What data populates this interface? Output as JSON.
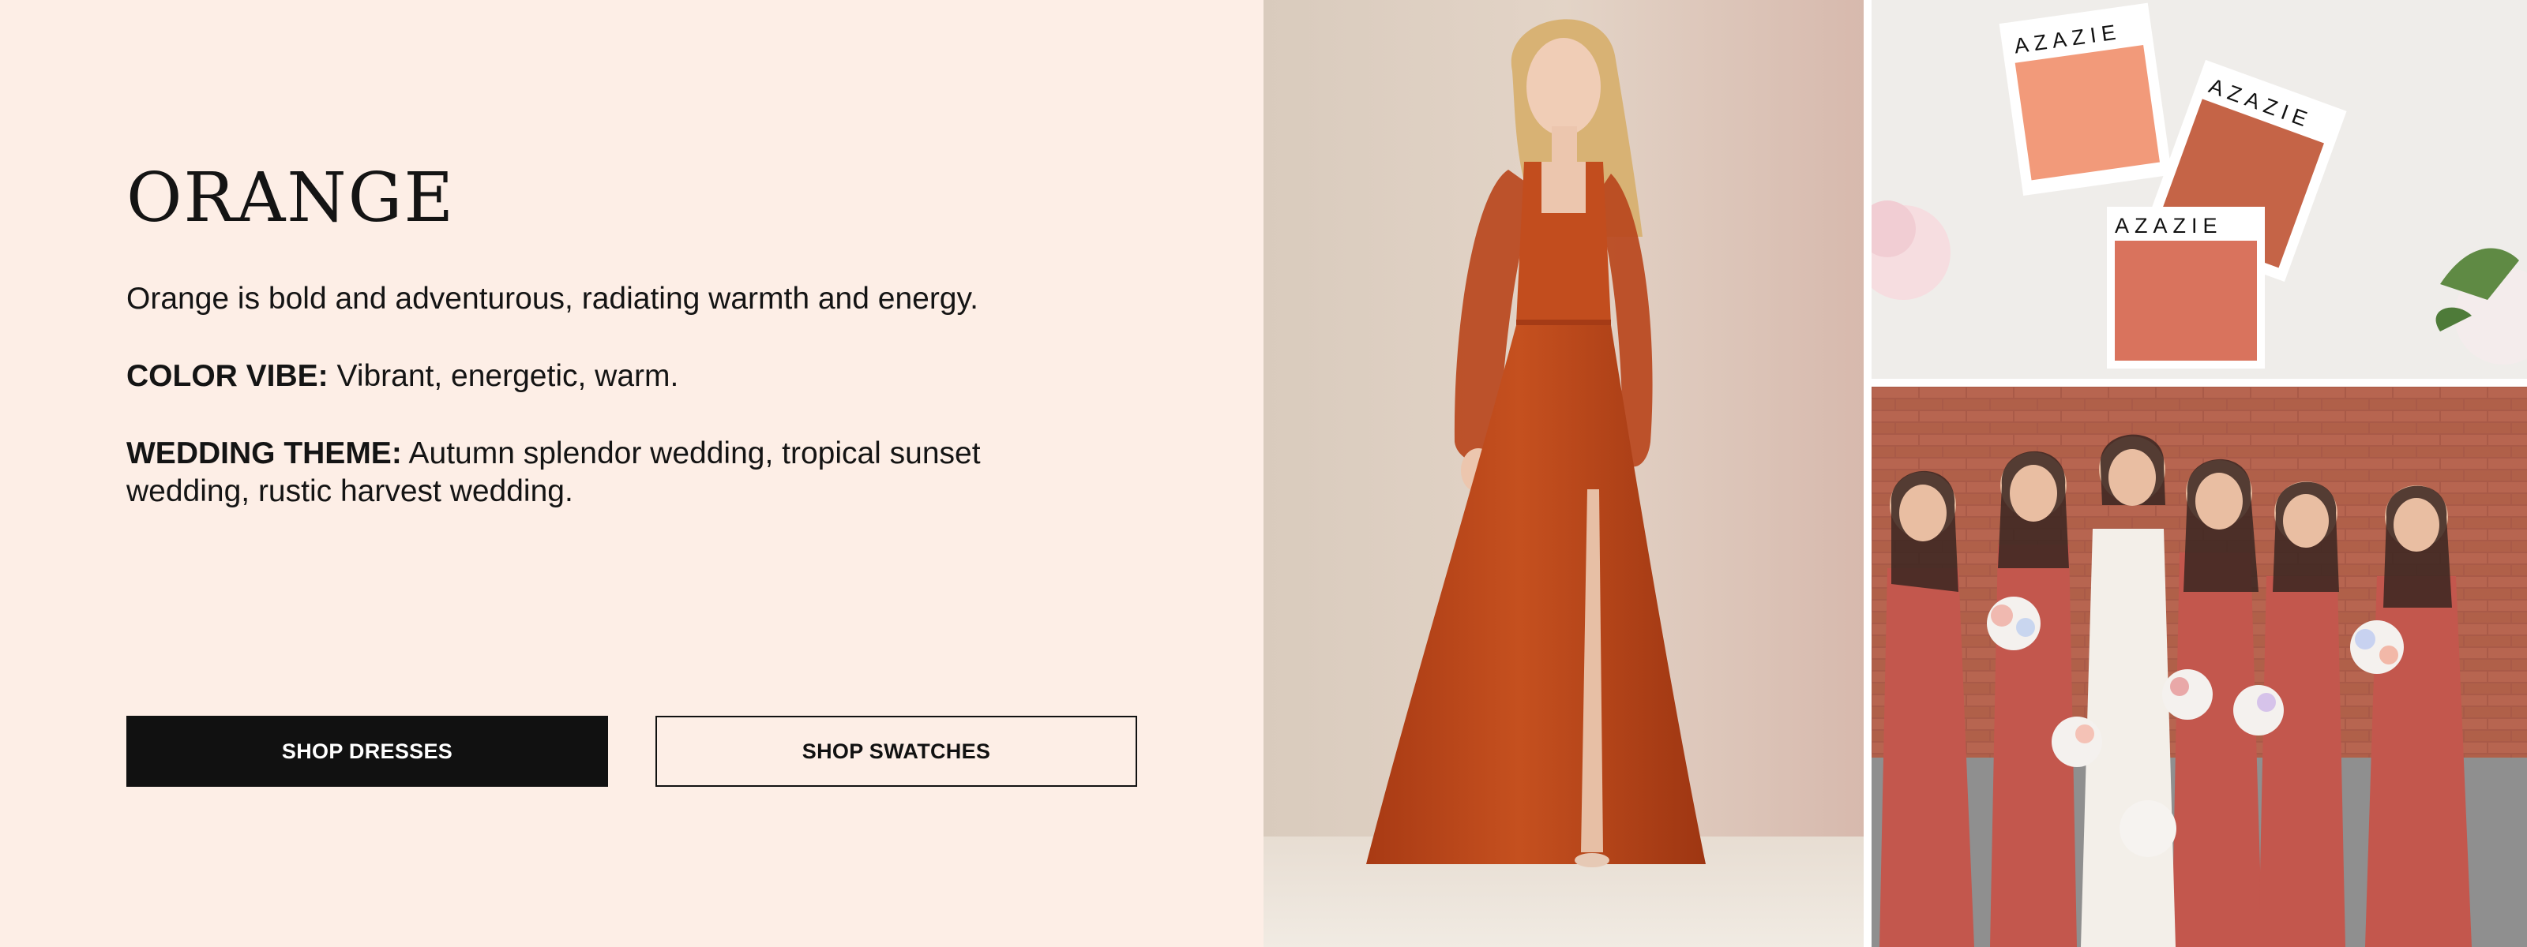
{
  "color_section": {
    "title": "ORANGE",
    "intro": "Orange is bold and adventurous, radiating warmth and energy.",
    "color_vibe": {
      "label": "COLOR VIBE:",
      "value": " Vibrant, energetic, warm."
    },
    "wedding_theme": {
      "label": "WEDDING THEME:",
      "value": " Autumn splendor wedding, tropical sunset wedding, rustic harvest wedding."
    }
  },
  "buttons": {
    "shop_dresses": "SHOP DRESSES",
    "shop_swatches": "SHOP SWATCHES"
  },
  "swatches": {
    "brand_label_1": "AZAZIE",
    "brand_label_2": "AZAZIE",
    "brand_label_3": "AZAZIE"
  },
  "colors": {
    "background": "#fdeee6",
    "button_dark": "#111111",
    "dress_orange": "#b5441c",
    "swatch_light": "#f29a7a",
    "swatch_mid": "#c56447",
    "swatch_coral": "#d9735d",
    "bridesmaid_dress": "#c3574d"
  }
}
